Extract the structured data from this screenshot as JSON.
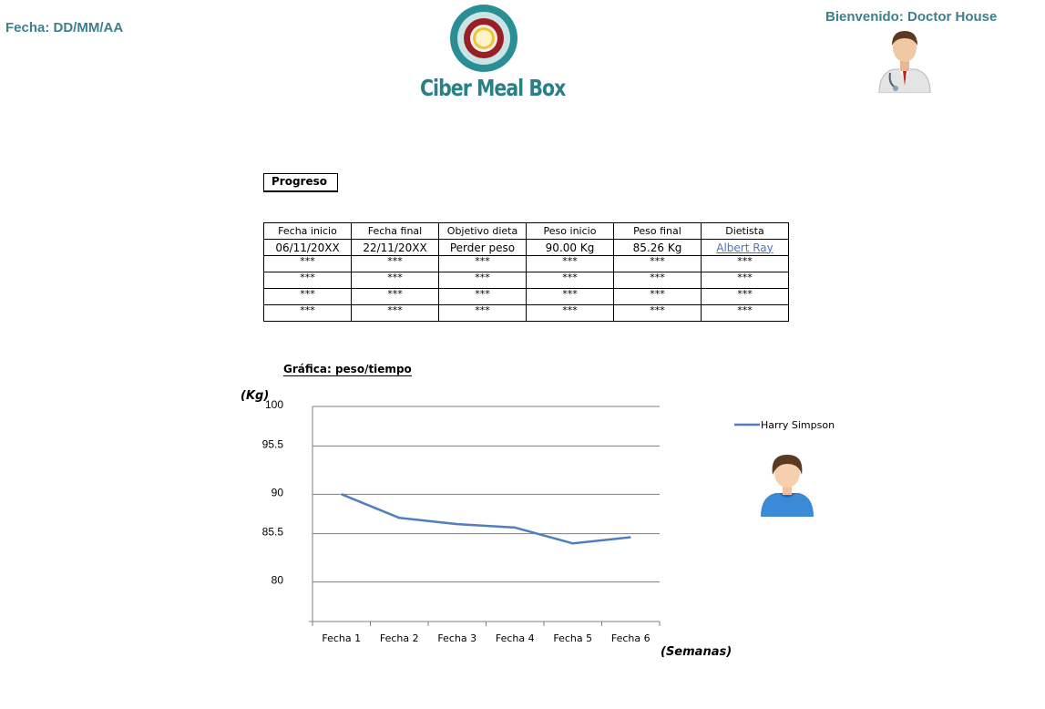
{
  "header": {
    "date_label": "Fecha: DD/MM/AA",
    "logo_text": "Ciber Meal Box",
    "welcome": "Bienvenido: Doctor House"
  },
  "icons": {
    "doctor_avatar": "doctor-avatar-icon",
    "patient_avatar": "patient-avatar-icon"
  },
  "progress_tab": {
    "label": "Progreso"
  },
  "table": {
    "headers": [
      "Fecha inicio",
      "Fecha final",
      "Objetivo dieta",
      "Peso inicio",
      "Peso final",
      "Dietista"
    ],
    "rows": [
      [
        "06/11/20XX",
        "22/11/20XX",
        "Perder peso",
        "90.00 Kg",
        "85.26 Kg",
        "Albert Ray"
      ],
      [
        "***",
        "***",
        "***",
        "***",
        "***",
        "***"
      ],
      [
        "***",
        "***",
        "***",
        "***",
        "***",
        "***"
      ],
      [
        "***",
        "***",
        "***",
        "***",
        "***",
        "***"
      ],
      [
        "***",
        "***",
        "***",
        "***",
        "***",
        "***"
      ]
    ]
  },
  "colors": {
    "accent_teal": "#3f7f8c",
    "line_series": "#4f7fbf",
    "link": "#4a78b8"
  },
  "chart_data": {
    "type": "line",
    "title": "Gráfica: peso/tiempo",
    "ylabel": "(Kg)",
    "xlabel": "(Semanas)",
    "categories": [
      "Fecha 1",
      "Fecha 2",
      "Fecha 3",
      "Fecha 4",
      "Fecha 5",
      "Fecha 6"
    ],
    "y_ticks": [
      "100",
      "95.5",
      "90",
      "85.5",
      "80"
    ],
    "series": [
      {
        "name": "Harry Simpson",
        "values": [
          90.0,
          87.3,
          86.6,
          86.2,
          84.4,
          85.1
        ]
      }
    ],
    "grid": true,
    "legend": "right"
  }
}
